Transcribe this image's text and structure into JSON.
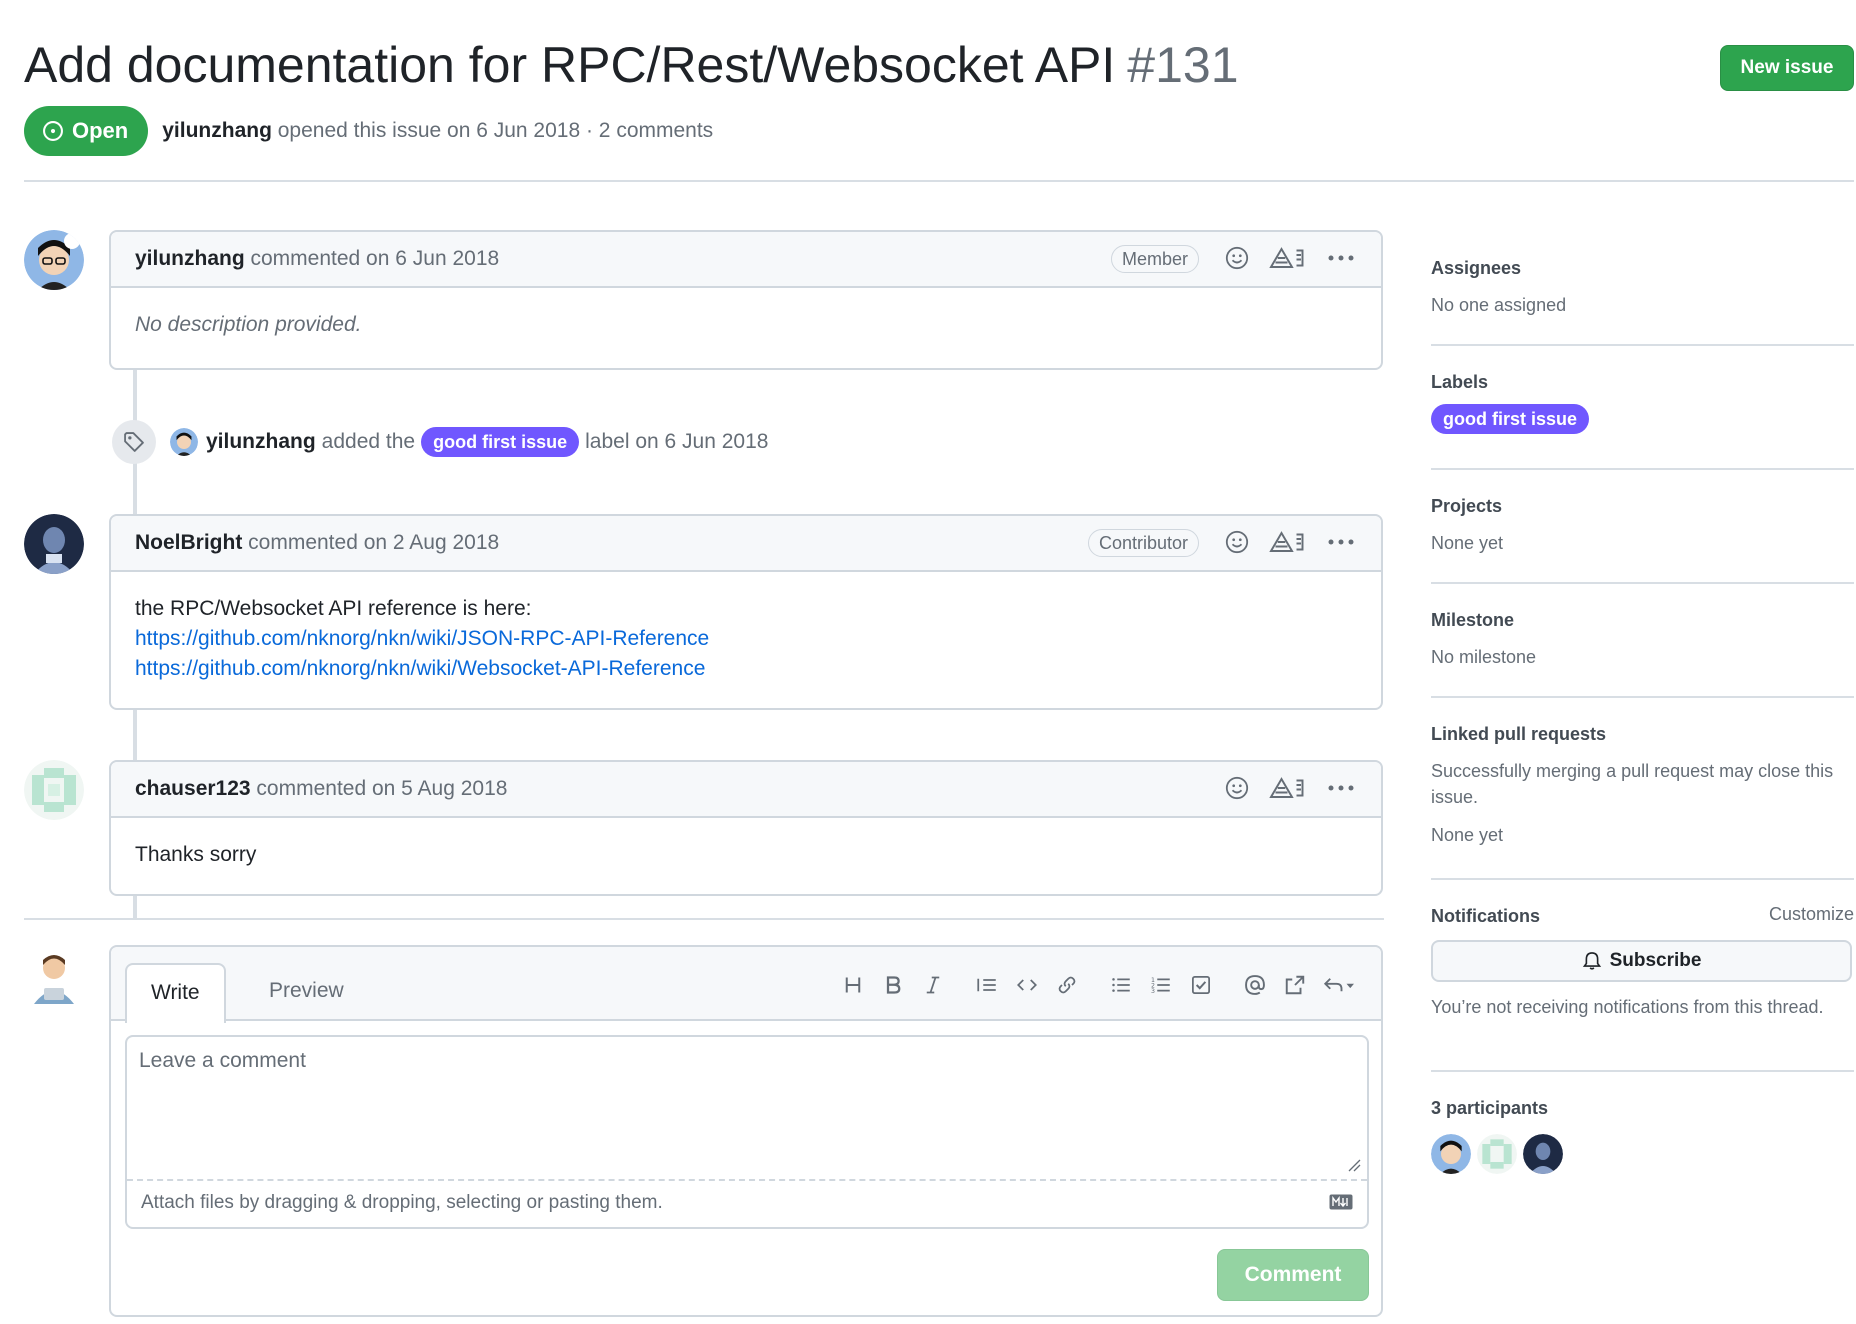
{
  "issue": {
    "title": "Add documentation for RPC/Rest/Websocket API",
    "number": "#131",
    "state": "Open",
    "author": "yilunzhang",
    "meta_rest": " opened this issue on 6 Jun 2018 · 2 comments",
    "new_issue_label": "New issue"
  },
  "comments": [
    {
      "author": "yilunzhang",
      "action": " commented on 6 Jun 2018",
      "role": "Member",
      "body": "No description provided."
    },
    {
      "author": "NoelBright",
      "action": " commented on 2 Aug 2018",
      "role": "Contributor",
      "body": "the RPC/Websocket API reference is here:",
      "links": [
        "https://github.com/nknorg/nkn/wiki/JSON-RPC-API-Reference",
        "https://github.com/nknorg/nkn/wiki/Websocket-API-Reference"
      ]
    },
    {
      "author": "chauser123",
      "action": " commented on 5 Aug 2018",
      "body": "Thanks sorry"
    }
  ],
  "event": {
    "actor": "yilunzhang",
    "text_before": "added the",
    "label": "good first issue",
    "text_after": "label on 6 Jun 2018"
  },
  "editor": {
    "tab_write": "Write",
    "tab_preview": "Preview",
    "placeholder": "Leave a comment",
    "attach_hint": "Attach files by dragging & dropping, selecting or pasting them.",
    "submit_label": "Comment"
  },
  "sidebar": {
    "assignees": {
      "title": "Assignees",
      "value": "No one assigned"
    },
    "labels": {
      "title": "Labels",
      "label": "good first issue"
    },
    "projects": {
      "title": "Projects",
      "value": "None yet"
    },
    "milestone": {
      "title": "Milestone",
      "value": "No milestone"
    },
    "linked_prs": {
      "title": "Linked pull requests",
      "description": "Successfully merging a pull request may close this issue.",
      "value": "None yet"
    },
    "notifications": {
      "title": "Notifications",
      "customize": "Customize",
      "subscribe": "Subscribe",
      "status": "You’re not receiving notifications from this thread."
    },
    "participants": {
      "title": "3 participants"
    }
  },
  "colors": {
    "open_green": "#2da44e",
    "label_purple": "#7057ff",
    "link_blue": "#0969da",
    "disabled_green": "#94d3a2"
  },
  "icons": [
    "issue-opened-icon",
    "smiley-icon",
    "copilot-icon",
    "kebab-horizontal-icon",
    "tag-icon",
    "heading-icon",
    "bold-icon",
    "italic-icon",
    "quote-icon",
    "code-icon",
    "link-icon",
    "list-unordered-icon",
    "list-ordered-icon",
    "tasklist-icon",
    "mention-icon",
    "cross-reference-icon",
    "reply-icon",
    "bell-icon",
    "markdown-icon"
  ]
}
